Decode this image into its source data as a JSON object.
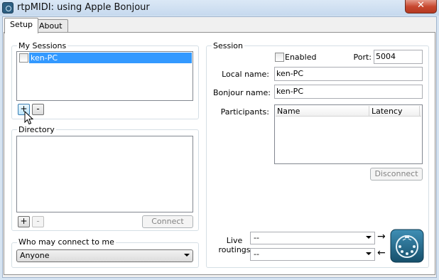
{
  "window": {
    "title": "rtpMIDI: using Apple Bonjour",
    "close_glyph": "✕"
  },
  "tabs": [
    {
      "label": "Setup",
      "active": true
    },
    {
      "label": "About",
      "active": false
    }
  ],
  "my_sessions": {
    "title": "My Sessions",
    "items": [
      {
        "label": "ken-PC",
        "checked": false,
        "selected": true
      }
    ],
    "add_label": "+",
    "remove_label": "-"
  },
  "directory": {
    "title": "Directory",
    "add_label": "+",
    "remove_label": "-",
    "connect_label": "Connect"
  },
  "who_may_connect": {
    "title": "Who may connect to me",
    "value": "Anyone"
  },
  "session": {
    "title": "Session",
    "enabled_label": "Enabled",
    "enabled_checked": false,
    "port_label": "Port:",
    "port_value": "5004",
    "local_name_label": "Local name:",
    "local_name_value": "ken-PC",
    "bonjour_name_label": "Bonjour name:",
    "bonjour_name_value": "ken-PC",
    "participants_label": "Participants:",
    "participants_columns": [
      "Name",
      "Latency"
    ],
    "disconnect_label": "Disconnect",
    "live_routings_label": "Live routings",
    "routing_in_value": "--",
    "routing_out_value": "--",
    "arrow_right": "→",
    "arrow_left": "←"
  },
  "colors": {
    "selection": "#3399ff",
    "midi_icon": "#1f6f93"
  }
}
